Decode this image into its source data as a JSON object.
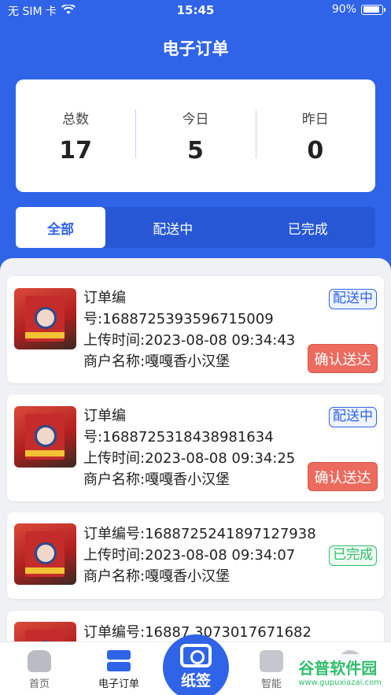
{
  "status_bar": {
    "carrier": "无 SIM 卡",
    "time": "15:45",
    "battery": "90%",
    "battery_level": 0.9
  },
  "header": {
    "title": "电子订单"
  },
  "stats": [
    {
      "label": "总数",
      "value": "17"
    },
    {
      "label": "今日",
      "value": "5"
    },
    {
      "label": "昨日",
      "value": "0"
    }
  ],
  "filter_tabs": [
    {
      "label": "全部",
      "active": true
    },
    {
      "label": "配送中",
      "active": false
    },
    {
      "label": "已完成",
      "active": false
    }
  ],
  "orders": [
    {
      "line1": "订单编",
      "line2": "号:1688725393596715009",
      "upload_time": "上传时间:2023-08-08 09:34:43",
      "merchant": "商户名称:嘎嘎香小汉堡",
      "status": "配送中",
      "action": "确认送达"
    },
    {
      "line1": "订单编",
      "line2": "号:1688725318438981634",
      "upload_time": "上传时间:2023-08-08 09:34:25",
      "merchant": "商户名称:嘎嘎香小汉堡",
      "status": "配送中",
      "action": "确认送达"
    },
    {
      "line1": "订单编号:1688725241897127938",
      "upload_time": "上传时间:2023-08-08 09:34:07",
      "merchant": "商户名称:嘎嘎香小汉堡",
      "status": "已完成"
    },
    {
      "line1": "订单编号:16887  3073017671682"
    }
  ],
  "tabbar": {
    "home": "首页",
    "orders": "电子订单",
    "scan": "纸签",
    "smart": "智能"
  },
  "watermark": {
    "main": "谷普软件园",
    "sub": "www.gupuxiazai.com"
  }
}
